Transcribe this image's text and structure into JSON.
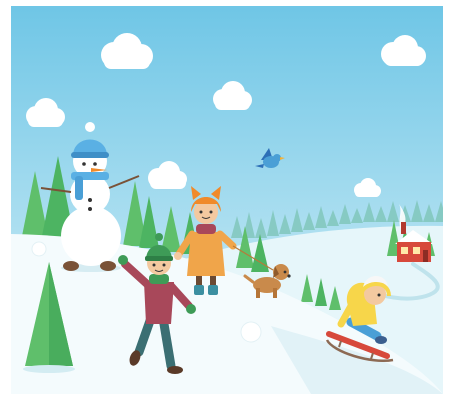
{
  "scene": {
    "elements": [
      "sky",
      "clouds",
      "snowy-hills",
      "pine-trees",
      "snowman",
      "girl-in-fox-hat",
      "dog",
      "bird",
      "boy-throwing-snowball",
      "child-on-sled",
      "house-with-chimney"
    ]
  },
  "colors": {
    "sky_top": "#6fc6e6",
    "sky_bottom": "#d9f1f8",
    "snow": "#f4fbfd",
    "snow_shadow": "#cfe9f1",
    "pine": "#5fbf6b",
    "pine_dark": "#3ea65a",
    "house": "#d7493b",
    "coat_orange": "#f0a54a",
    "jacket_purple": "#a8485a",
    "jacket_yellow": "#f7d64a",
    "scarf_blue": "#5ab0e4"
  }
}
